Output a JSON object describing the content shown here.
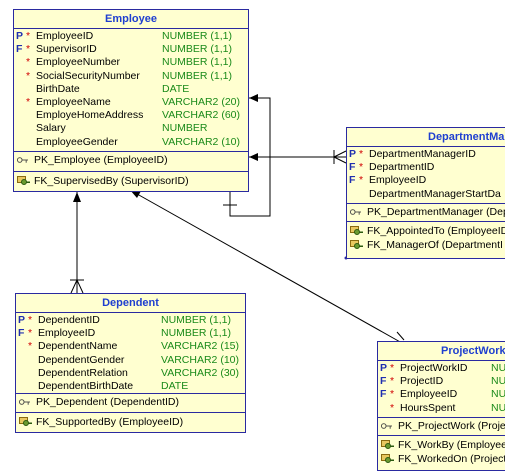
{
  "tables": {
    "employee": {
      "title": "Employee",
      "columns": [
        {
          "m1": "P",
          "m2": "*",
          "name": "EmployeeID",
          "type": "NUMBER (1,1)"
        },
        {
          "m1": "F",
          "m2": "*",
          "name": "SupervisorID",
          "type": "NUMBER (1,1)"
        },
        {
          "m1": "",
          "m2": "*",
          "name": "EmployeeNumber",
          "type": "NUMBER (1,1)"
        },
        {
          "m1": "",
          "m2": "*",
          "name": "SocialSecurityNumber",
          "type": "NUMBER (1,1)"
        },
        {
          "m1": "",
          "m2": "",
          "name": "BirthDate",
          "type": "DATE"
        },
        {
          "m1": "",
          "m2": "*",
          "name": "EmployeeName",
          "type": "VARCHAR2 (20)"
        },
        {
          "m1": "",
          "m2": "",
          "name": "EmployeHomeAddress",
          "type": "VARCHAR2 (60)"
        },
        {
          "m1": "",
          "m2": "",
          "name": "Salary",
          "type": "NUMBER"
        },
        {
          "m1": "",
          "m2": "",
          "name": "EmployeeGender",
          "type": "VARCHAR2 (10)"
        }
      ],
      "pk": "PK_Employee (EmployeeID)",
      "fks": [
        "FK_SupervisedBy (SupervisorID)"
      ]
    },
    "department_manager": {
      "title": "DepartmentMa",
      "columns": [
        {
          "m1": "P",
          "m2": "*",
          "name": "DepartmentManagerID",
          "type": ""
        },
        {
          "m1": "F",
          "m2": "*",
          "name": "DepartmentID",
          "type": ""
        },
        {
          "m1": "F",
          "m2": "*",
          "name": "EmployeeID",
          "type": ""
        },
        {
          "m1": "",
          "m2": "",
          "name": "DepartmentManagerStartDa",
          "type": ""
        }
      ],
      "pk": "PK_DepartmentManager (Dep",
      "fks": [
        "FK_AppointedTo (EmployeeID",
        "FK_ManagerOf (DepartmentI"
      ]
    },
    "dependent": {
      "title": "Dependent",
      "columns": [
        {
          "m1": "P",
          "m2": "*",
          "name": "DependentID",
          "type": "NUMBER (1,1)"
        },
        {
          "m1": "F",
          "m2": "*",
          "name": "EmployeeID",
          "type": "NUMBER (1,1)"
        },
        {
          "m1": "",
          "m2": "*",
          "name": "DependentName",
          "type": "VARCHAR2 (15)"
        },
        {
          "m1": "",
          "m2": "",
          "name": "DependentGender",
          "type": "VARCHAR2 (10)"
        },
        {
          "m1": "",
          "m2": "",
          "name": "DependentRelation",
          "type": "VARCHAR2 (30)"
        },
        {
          "m1": "",
          "m2": "",
          "name": "DependentBirthDate",
          "type": "DATE"
        }
      ],
      "pk": "PK_Dependent (DependentID)",
      "fks": [
        "FK_SupportedBy (EmployeeID)"
      ]
    },
    "project_work": {
      "title": "ProjectWork",
      "columns": [
        {
          "m1": "P",
          "m2": "*",
          "name": "ProjectWorkID",
          "type": "NU"
        },
        {
          "m1": "F",
          "m2": "*",
          "name": "ProjectID",
          "type": "NU"
        },
        {
          "m1": "F",
          "m2": "*",
          "name": "EmployeeID",
          "type": "NU"
        },
        {
          "m1": "",
          "m2": "*",
          "name": "HoursSpent",
          "type": "NU"
        }
      ],
      "pk": "PK_ProjectWork (Projec",
      "fks": [
        "FK_WorkBy (EmployeeI",
        "FK_WorkedOn (Project"
      ]
    }
  },
  "colors": {
    "header_text": "#1f3fd0",
    "border": "#2a2aa0",
    "fill": "#ffffd0",
    "type_text": "#1a8a1a",
    "mandatory": "#d00000"
  }
}
